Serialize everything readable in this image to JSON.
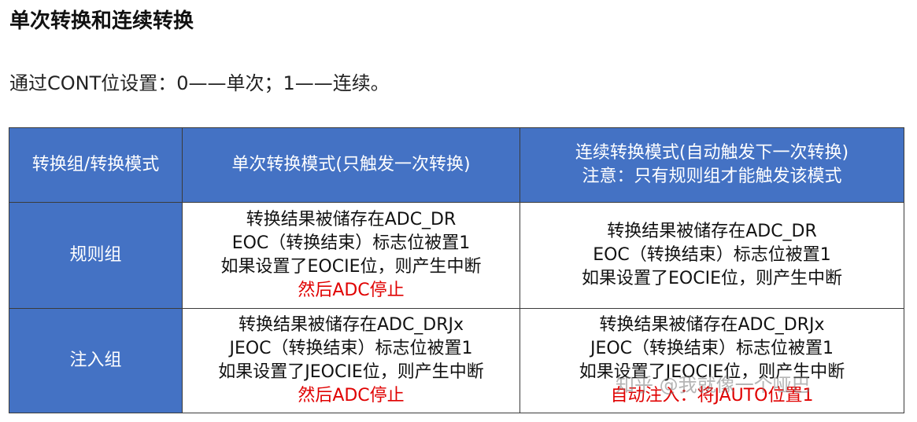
{
  "heading": "单次转换和连续转换",
  "intro": "通过CONT位设置：0——单次；1——连续。",
  "table": {
    "headers": [
      [
        "转换组/转换模式"
      ],
      [
        "单次转换模式(只触发一次转换)"
      ],
      [
        "连续转换模式(自动触发下一次转换)",
        "注意：只有规则组才能触发该模式"
      ]
    ],
    "rows": [
      {
        "label": "规则组",
        "single": [
          "转换结果被储存在ADC_DR",
          "EOC（转换结束）标志位被置1",
          "如果设置了EOCIE位，则产生中断"
        ],
        "single_red": "然后ADC停止",
        "continuous": [
          "转换结果被储存在ADC_DR",
          "EOC（转换结束）标志位被置1",
          "如果设置了EOCIE位，则产生中断"
        ],
        "continuous_red": ""
      },
      {
        "label": "注入组",
        "single": [
          "转换结果被储存在ADC_DRJx",
          "JEOC（转换结束）标志位被置1",
          "如果设置了JEOCIE位，则产生中断"
        ],
        "single_red": "然后ADC停止",
        "continuous": [
          "转换结果被储存在ADC_DRJx",
          "JEOC（转换结束）标志位被置1",
          "如果设置了JEOCIE位，则产生中断"
        ],
        "continuous_red": "自动注入：将JAUTO位置1"
      }
    ]
  },
  "watermark": "知乎 @我就像一个哑巴",
  "colors": {
    "header_bg": "#4472c4",
    "header_text": "#ffffff",
    "highlight": "#e00000"
  }
}
